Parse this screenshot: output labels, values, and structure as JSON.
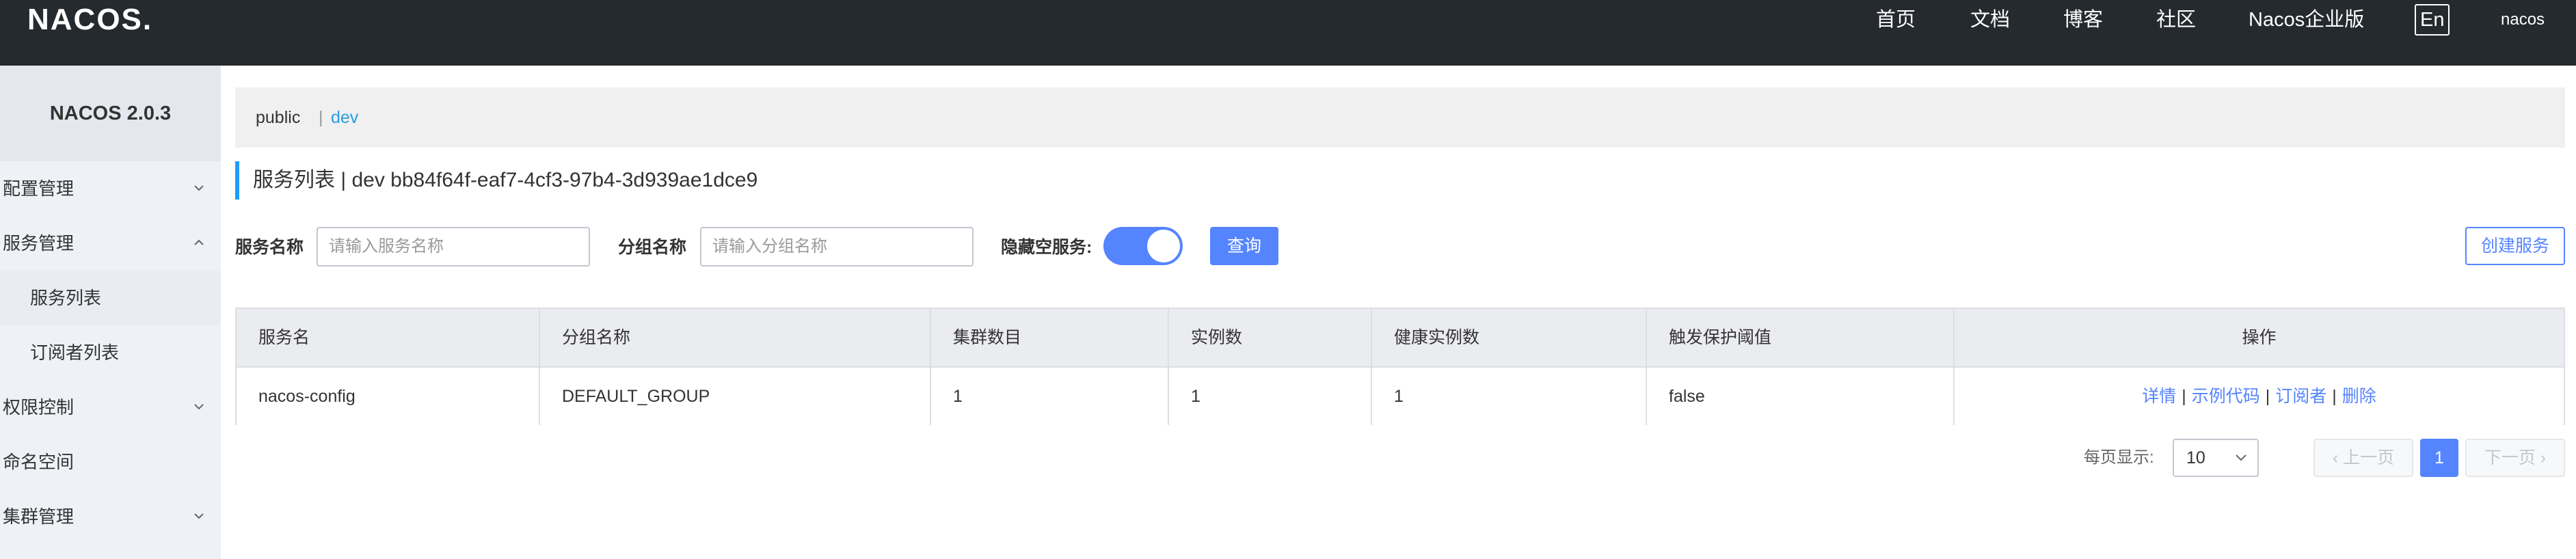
{
  "header": {
    "logo": "NACOS.",
    "nav": [
      "首页",
      "文档",
      "博客",
      "社区",
      "Nacos企业版"
    ],
    "lang_button": "En",
    "user": "nacos"
  },
  "sidebar": {
    "version": "NACOS 2.0.3",
    "items": [
      {
        "label": "配置管理",
        "expandable": true,
        "expanded": false
      },
      {
        "label": "服务管理",
        "expandable": true,
        "expanded": true
      },
      {
        "label": "服务列表",
        "sub": true,
        "active": true
      },
      {
        "label": "订阅者列表",
        "sub": true
      },
      {
        "label": "权限控制",
        "expandable": true,
        "expanded": false
      },
      {
        "label": "命名空间",
        "expandable": false
      },
      {
        "label": "集群管理",
        "expandable": true,
        "expanded": false
      }
    ]
  },
  "namespace": {
    "public": "public",
    "separator": "|",
    "dev": "dev"
  },
  "page": {
    "title": "服务列表  |  dev  bb84f64f-eaf7-4cf3-97b4-3d939ae1dce9"
  },
  "filters": {
    "service_name_label": "服务名称",
    "service_name_placeholder": "请输入服务名称",
    "group_name_label": "分组名称",
    "group_name_placeholder": "请输入分组名称",
    "hide_empty_label": "隐藏空服务:",
    "hide_empty_on": true,
    "query_button": "查询",
    "create_button": "创建服务"
  },
  "table": {
    "columns": [
      "服务名",
      "分组名称",
      "集群数目",
      "实例数",
      "健康实例数",
      "触发保护阈值",
      "操作"
    ],
    "rows": [
      {
        "service": "nacos-config",
        "group": "DEFAULT_GROUP",
        "clusters": "1",
        "instances": "1",
        "healthy": "1",
        "threshold": "false",
        "ops": [
          "详情",
          "示例代码",
          "订阅者",
          "删除"
        ]
      }
    ]
  },
  "pagination": {
    "size_label": "每页显示:",
    "page_size": "10",
    "prev": "上一页",
    "current": "1",
    "next": "下一页"
  },
  "colors": {
    "topbar": "#252a2f",
    "primary": "#5584ff",
    "link_blue": "#2a9de2"
  }
}
